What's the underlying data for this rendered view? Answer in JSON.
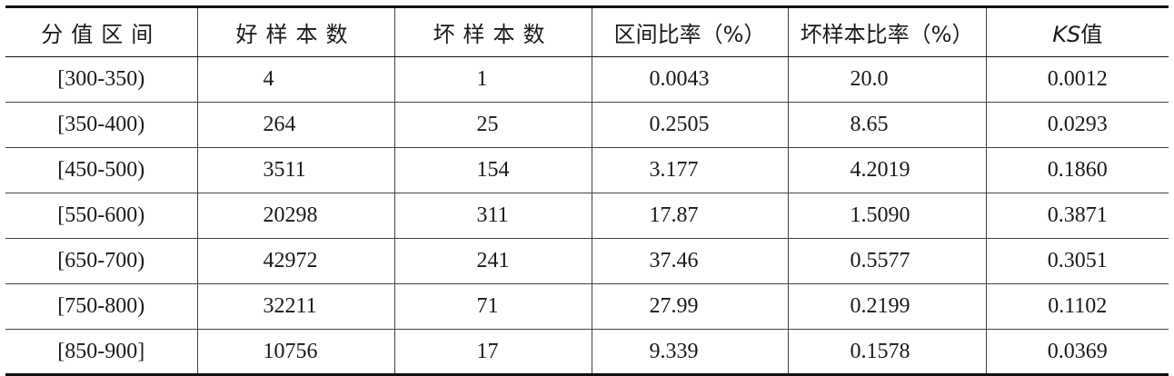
{
  "table": {
    "headers": {
      "range": "分值区间",
      "good": "好样本数",
      "bad": "坏样本数",
      "interval_ratio": "区间比率（%）",
      "bad_ratio": "坏样本比率（%）",
      "ks_prefix": "KS",
      "ks_suffix": "值"
    },
    "rows": [
      {
        "range": "[300-350)",
        "good": "4",
        "bad": "1",
        "interval_ratio": "0.0043",
        "bad_ratio": "20.0",
        "ks": "0.0012"
      },
      {
        "range": "[350-400)",
        "good": "264",
        "bad": "25",
        "interval_ratio": "0.2505",
        "bad_ratio": "8.65",
        "ks": "0.0293"
      },
      {
        "range": "[450-500)",
        "good": "3511",
        "bad": "154",
        "interval_ratio": "3.177",
        "bad_ratio": "4.2019",
        "ks": "0.1860"
      },
      {
        "range": "[550-600)",
        "good": "20298",
        "bad": "311",
        "interval_ratio": "17.87",
        "bad_ratio": "1.5090",
        "ks": "0.3871"
      },
      {
        "range": "[650-700)",
        "good": "42972",
        "bad": "241",
        "interval_ratio": "37.46",
        "bad_ratio": "0.5577",
        "ks": "0.3051"
      },
      {
        "range": "[750-800)",
        "good": "32211",
        "bad": "71",
        "interval_ratio": "27.99",
        "bad_ratio": "0.2199",
        "ks": "0.1102"
      },
      {
        "range": "[850-900]",
        "good": "10756",
        "bad": "17",
        "interval_ratio": "9.339",
        "bad_ratio": "0.1578",
        "ks": "0.0369"
      }
    ]
  }
}
